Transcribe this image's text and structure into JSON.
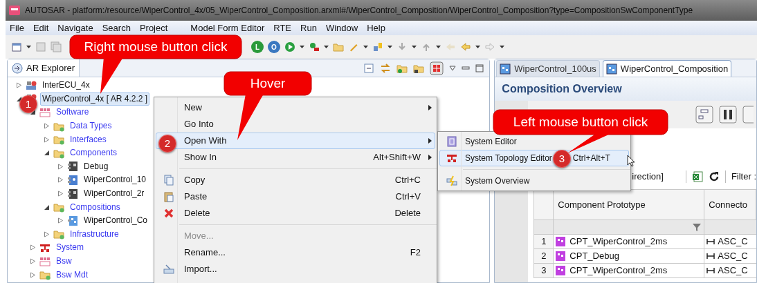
{
  "window": {
    "title": "AUTOSAR - platform:/resource/WiperControl_4x/05_WiperControl_Composition.arxml#/WiperControl_Composition/WiperControl_Composition?type=CompositionSwComponentType"
  },
  "menu_bar": [
    "File",
    "Edit",
    "Navigate",
    "Search",
    "Project",
    "Model Form Editor",
    "RTE",
    "Run",
    "Window",
    "Help"
  ],
  "toolbar": {
    "letter_buttons": [
      "L",
      "O"
    ]
  },
  "explorer": {
    "tab": "AR Explorer",
    "tree": [
      {
        "label": "InterECU_4x",
        "kind": "project",
        "expanded": false,
        "selected": false
      },
      {
        "label": "WiperControl_4x [ AR 4.2.2 ]",
        "kind": "project",
        "expanded": true,
        "selected": true,
        "children": [
          {
            "label": "Software",
            "kind": "package",
            "expanded": true,
            "selected": false,
            "children": [
              {
                "label": "Data Types",
                "kind": "folder",
                "expanded": false,
                "selected": false
              },
              {
                "label": "Interfaces",
                "kind": "folder",
                "expanded": false,
                "selected": false
              },
              {
                "label": "Components",
                "kind": "folder",
                "expanded": true,
                "selected": false,
                "children": [
                  {
                    "label": "Debug",
                    "kind": "component",
                    "expanded": false,
                    "selected": false
                  },
                  {
                    "label": "WiperControl_10",
                    "kind": "component_blue",
                    "expanded": false,
                    "selected": false
                  },
                  {
                    "label": "WiperControl_2r",
                    "kind": "component",
                    "expanded": false,
                    "selected": false
                  }
                ]
              },
              {
                "label": "Compositions",
                "kind": "folder",
                "expanded": true,
                "selected": false,
                "children": [
                  {
                    "label": "WiperControl_Co",
                    "kind": "composition",
                    "expanded": false,
                    "selected": false
                  }
                ]
              },
              {
                "label": "Infrastructure",
                "kind": "folder",
                "expanded": false,
                "selected": false
              }
            ]
          },
          {
            "label": "System",
            "kind": "system",
            "expanded": false,
            "selected": false
          },
          {
            "label": "Bsw",
            "kind": "package",
            "expanded": false,
            "selected": false
          },
          {
            "label": "Bsw Mdt",
            "kind": "folder",
            "expanded": false,
            "selected": false
          }
        ]
      }
    ]
  },
  "context_menu": {
    "items": [
      {
        "kind": "plain",
        "label": "New",
        "submenu": true,
        "hover": false,
        "disabled": false
      },
      {
        "kind": "plain",
        "label": "Go Into",
        "submenu": false,
        "hover": false,
        "disabled": false
      },
      {
        "kind": "plain",
        "label": "Open With",
        "submenu": true,
        "hover": true,
        "disabled": false
      },
      {
        "kind": "plain",
        "label": "Show In",
        "shortcut": "Alt+Shift+W",
        "submenu": true,
        "hover": false,
        "disabled": false
      },
      {
        "kind": "separator"
      },
      {
        "kind": "copy",
        "label": "Copy",
        "shortcut": "Ctrl+C",
        "submenu": false,
        "hover": false,
        "disabled": false
      },
      {
        "kind": "paste",
        "label": "Paste",
        "shortcut": "Ctrl+V",
        "submenu": false,
        "hover": false,
        "disabled": false
      },
      {
        "kind": "delete",
        "label": "Delete",
        "shortcut": "Delete",
        "submenu": false,
        "hover": false,
        "disabled": false
      },
      {
        "kind": "separator"
      },
      {
        "kind": "plain",
        "label": "Move...",
        "submenu": false,
        "hover": false,
        "disabled": true
      },
      {
        "kind": "plain",
        "label": "Rename...",
        "shortcut": "F2",
        "submenu": false,
        "hover": false,
        "disabled": false
      },
      {
        "kind": "import",
        "label": "Import...",
        "submenu": false,
        "hover": false,
        "disabled": false
      }
    ]
  },
  "submenu": {
    "items": [
      {
        "kind": "system_editor",
        "label": "System Editor",
        "hover": false
      },
      {
        "kind": "topology",
        "label": "System Topology Editor",
        "shortcut": "Ctrl+Alt+T",
        "hover": true
      },
      {
        "kind": "separator"
      },
      {
        "kind": "overview",
        "label": "System Overview",
        "hover": false
      }
    ]
  },
  "editor": {
    "tabs": [
      {
        "label": "WiperControl_100us",
        "selected": false
      },
      {
        "label": "WiperControl_Composition",
        "selected": true
      }
    ],
    "title": "Composition Overview",
    "filter_bar": {
      "direction": "irection]",
      "filter_label": "Filter :"
    },
    "table": {
      "columns": [
        "Component Prototype",
        "Connecto"
      ],
      "rows": [
        {
          "index": "1",
          "prototype": "CPT_WiperControl_2ms",
          "connector": "ASC_C"
        },
        {
          "index": "2",
          "prototype": "CPT_Debug",
          "connector": "ASC_C"
        },
        {
          "index": "3",
          "prototype": "CPT_WiperControl_2ms",
          "connector": "ASC_C"
        }
      ]
    }
  },
  "callouts": [
    "Right mouse button click",
    "Hover",
    "Left mouse button click"
  ],
  "badges": [
    "1",
    "2",
    "3"
  ]
}
